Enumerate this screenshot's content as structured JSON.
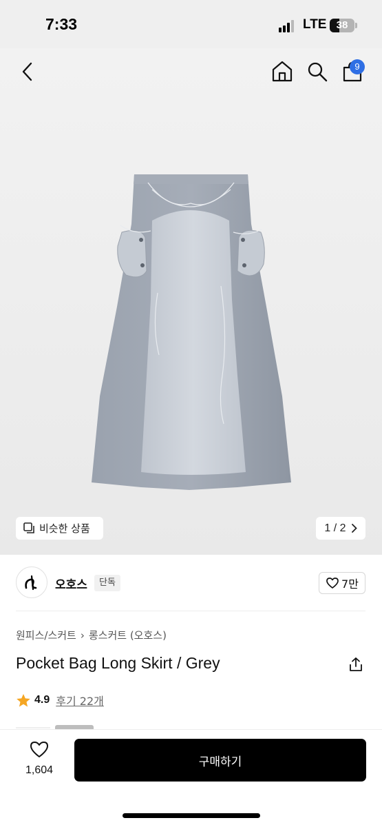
{
  "status_bar": {
    "time": "7:33",
    "network": "LTE",
    "battery": "38",
    "battery_level_percent": 38
  },
  "top_nav": {
    "back_icon": "chevron-left-icon",
    "home_icon": "home-icon",
    "search_icon": "search-icon",
    "cart_icon": "shopping-bag-icon",
    "cart_badge": "9",
    "badge_color": "#2f6fe4"
  },
  "gallery": {
    "similar_button_label": "비슷한 상품",
    "page_indicator": "1 / 2"
  },
  "brand": {
    "name": "오호스",
    "badge": "단독",
    "likes": "7만"
  },
  "product": {
    "breadcrumb": [
      "원피스/스커트",
      "롱스커트 (오호스)"
    ],
    "title": "Pocket Bag Long Skirt / Grey",
    "rating": "4.9",
    "review_link": "후기 22개",
    "star_color": "#f5a623"
  },
  "bottom_bar": {
    "wish_count": "1,604",
    "buy_label": "구매하기"
  }
}
